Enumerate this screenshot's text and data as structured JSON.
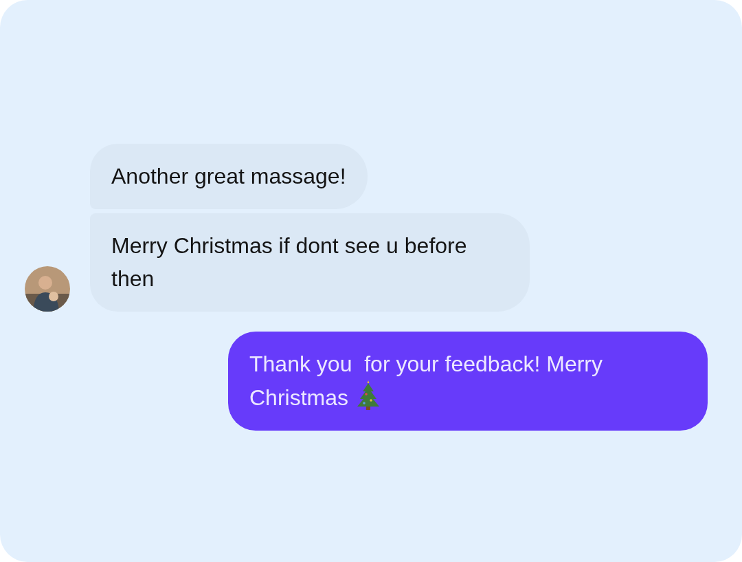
{
  "messages": [
    {
      "kind": "incoming",
      "text": "Another great massage!",
      "show_avatar": false
    },
    {
      "kind": "incoming",
      "text": "Merry Christmas if dont see u before then",
      "show_avatar": true
    },
    {
      "kind": "outgoing",
      "text": "Thank you  for your feedback! Merry Christmas",
      "tree_icon": true
    }
  ]
}
